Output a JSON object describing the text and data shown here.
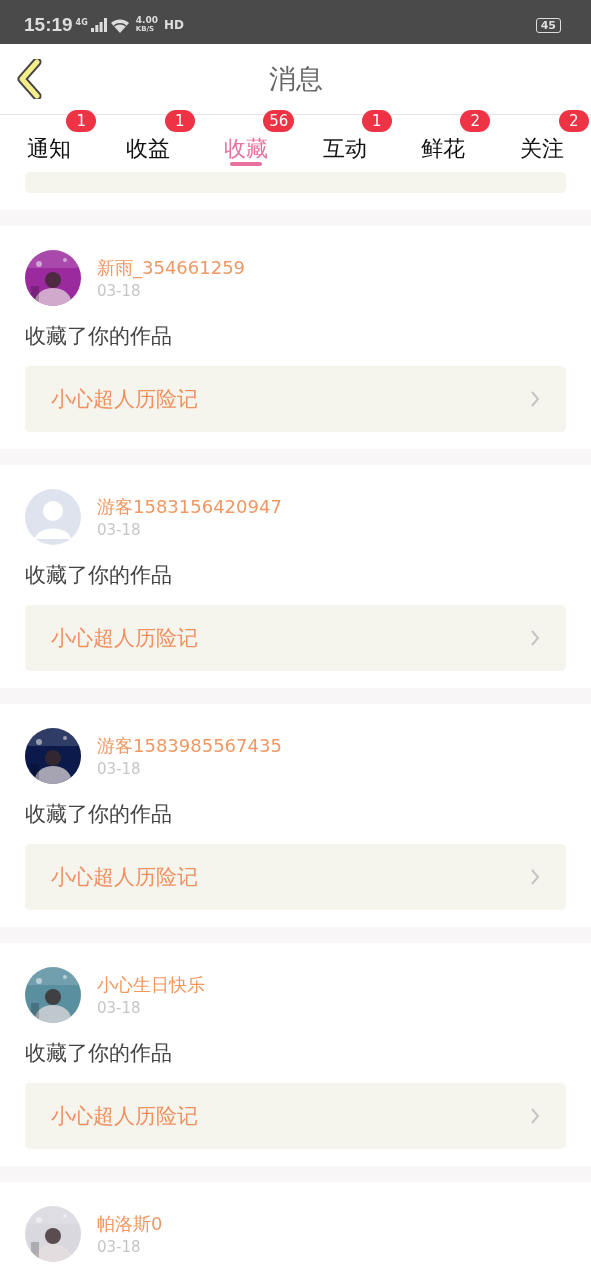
{
  "status_bar": {
    "time": "15:19",
    "network": "4G",
    "speed": "4.00",
    "speed_unit": "KB/S",
    "hd": "HD",
    "battery": "45"
  },
  "header": {
    "title": "消息"
  },
  "tabs": [
    {
      "label": "通知",
      "badge": "1",
      "selected": false
    },
    {
      "label": "收益",
      "badge": "1",
      "selected": false
    },
    {
      "label": "收藏",
      "badge": "56",
      "selected": true
    },
    {
      "label": "互动",
      "badge": "1",
      "selected": false
    },
    {
      "label": "鲜花",
      "badge": "2",
      "selected": false
    },
    {
      "label": "关注",
      "badge": "2",
      "selected": false
    }
  ],
  "items": [
    {
      "name": "新雨_354661259",
      "date": "03-18",
      "action": "收藏了你的作品",
      "work": "小心超人历险记"
    },
    {
      "avatar": {
        "kind": "default"
      },
      "name": "游客1583156420947",
      "date": "03-18",
      "action": "收藏了你的作品",
      "work": "小心超人历险记"
    },
    {
      "name": "游客1583985567435",
      "date": "03-18",
      "action": "收藏了你的作品",
      "work": "小心超人历险记"
    },
    {
      "name": "小心生日快乐",
      "date": "03-18",
      "action": "收藏了你的作品",
      "work": "小心超人历险记"
    },
    {
      "name": "帕洛斯0",
      "date": "03-18"
    }
  ]
}
